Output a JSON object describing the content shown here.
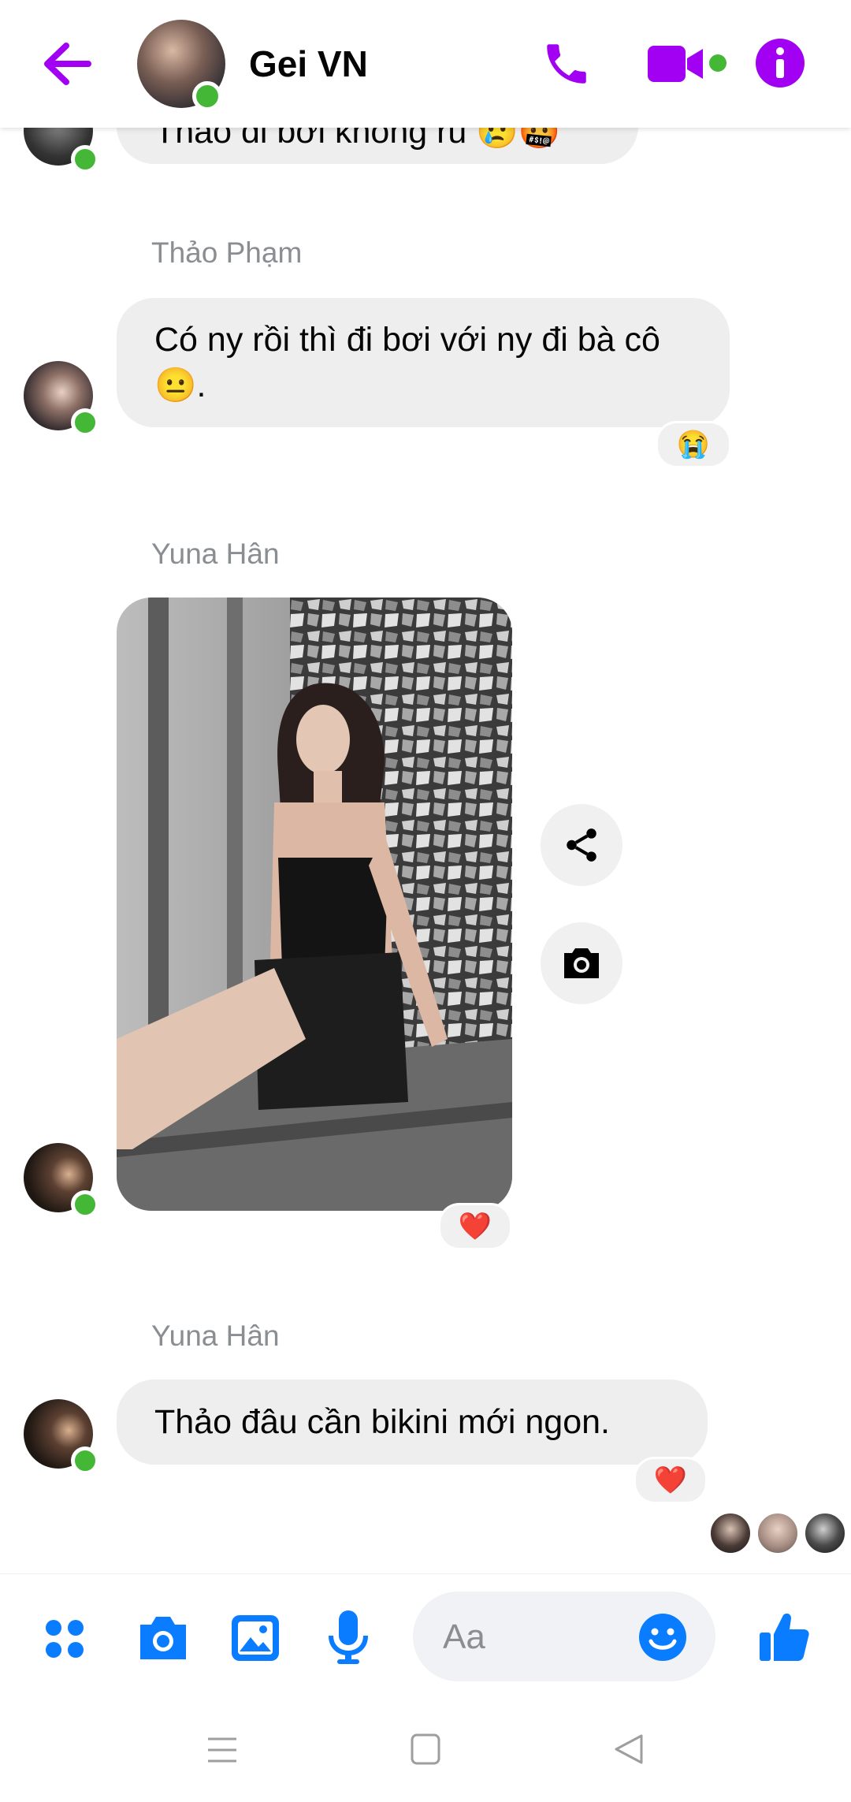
{
  "header": {
    "title": "Gei VN",
    "accent_color": "#a100f2",
    "icons": [
      "back-arrow-icon",
      "phone-icon",
      "video-camera-icon",
      "info-icon"
    ]
  },
  "messages": [
    {
      "sender": "",
      "text": "Thảo đi bơi không rủ 😢🤬"
    },
    {
      "sender": "Thảo Phạm",
      "text": "Có ny rồi thì đi bơi với ny đi bà cô 😐.",
      "reaction": "😭"
    },
    {
      "sender": "Yuna Hân",
      "type": "photo",
      "reaction": "❤️"
    },
    {
      "sender": "Yuna Hân",
      "text": "Thảo đâu cần bikini mới ngon.",
      "reaction": "❤️"
    }
  ],
  "composer": {
    "placeholder": "Aa",
    "brand_color": "#0a7cff",
    "icons": [
      "menu-dots-icon",
      "camera-icon",
      "gallery-icon",
      "microphone-icon",
      "emoji-icon",
      "like-icon"
    ]
  },
  "navbar": {
    "icons": [
      "recent-apps-icon",
      "home-icon",
      "back-icon"
    ]
  }
}
